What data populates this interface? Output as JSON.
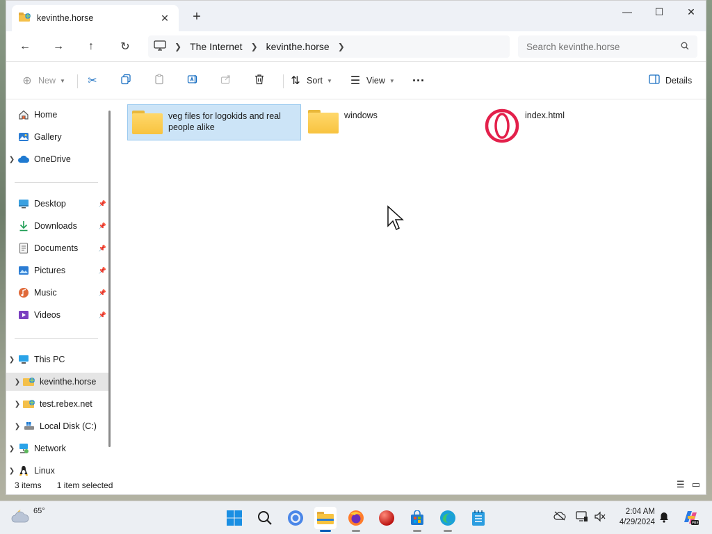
{
  "window": {
    "tab_title": "kevinthe.horse",
    "tab_close": "✕",
    "new_tab": "+",
    "controls": {
      "minimize": "—",
      "maximize": "☐",
      "close": "✕"
    }
  },
  "nav": {
    "back": "←",
    "forward": "→",
    "up": "↑",
    "refresh": "↻",
    "breadcrumb": [
      "The Internet",
      "kevinthe.horse"
    ],
    "search_placeholder": "Search kevinthe.horse"
  },
  "toolbar": {
    "new_label": "New",
    "sort_label": "Sort",
    "view_label": "View",
    "more": "···",
    "details_label": "Details"
  },
  "sidebar": {
    "top": [
      {
        "label": "Home"
      },
      {
        "label": "Gallery"
      },
      {
        "label": "OneDrive"
      }
    ],
    "quick": [
      {
        "label": "Desktop"
      },
      {
        "label": "Downloads"
      },
      {
        "label": "Documents"
      },
      {
        "label": "Pictures"
      },
      {
        "label": "Music"
      },
      {
        "label": "Videos"
      }
    ],
    "this_pc": "This PC",
    "drives": [
      {
        "label": "kevinthe.horse"
      },
      {
        "label": "test.rebex.net"
      },
      {
        "label": "Local Disk (C:)"
      }
    ],
    "network": "Network",
    "linux": "Linux"
  },
  "files": [
    {
      "name": "veg files for logokids and real people alike",
      "type": "folder",
      "selected": true
    },
    {
      "name": "windows",
      "type": "folder",
      "selected": false
    },
    {
      "name": "index.html",
      "type": "opera-html",
      "selected": false
    }
  ],
  "status": {
    "items": "3 items",
    "selected": "1 item selected"
  },
  "taskbar": {
    "temperature": "65°",
    "time": "2:04 AM",
    "date": "4/29/2024"
  },
  "colors": {
    "selection_bg": "#cce4f7",
    "accent": "#005fb8",
    "folder": "#f8c33f",
    "opera": "#e3204b"
  }
}
